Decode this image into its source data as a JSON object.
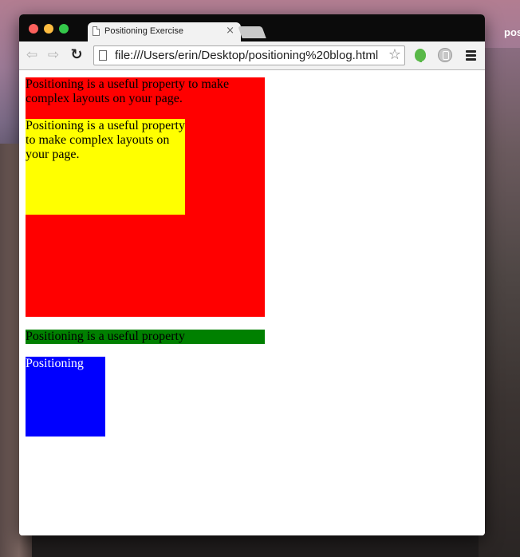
{
  "desktop": {
    "label": "pos"
  },
  "window": {
    "tab": {
      "title": "Positioning Exercise",
      "close": "×"
    },
    "toolbar": {
      "back": "⇦",
      "forward": "⇨",
      "reload": "↻",
      "url": "file:///Users/erin/Desktop/positioning%20blog.html",
      "bookmark": "☆"
    }
  },
  "page": {
    "red_text": "Positioning is a useful property to make complex layouts on your page.",
    "yellow_text": "Positioning is a useful property to make complex layouts on your page.",
    "green_text": "Positioning is a useful property",
    "blue_text": "Positioning"
  },
  "colors": {
    "red": "#ff0000",
    "yellow": "#ffff00",
    "green": "#008000",
    "blue": "#0000ff"
  }
}
